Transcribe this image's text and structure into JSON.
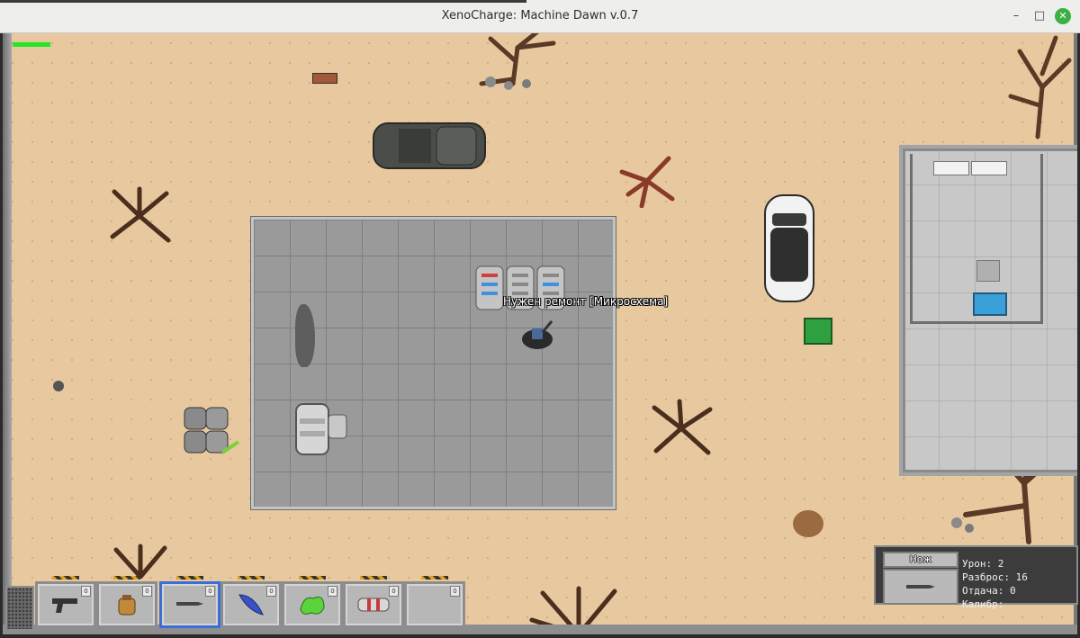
{
  "window": {
    "title": "XenoCharge: Machine Dawn v.0.7",
    "minimize": "–",
    "maximize": "□",
    "close": "✕"
  },
  "hud": {
    "health_fraction": 1.0,
    "health_color": "#24e624",
    "interaction_hint": "Нужен ремонт [Микросхема]"
  },
  "hotbar": {
    "selected_index": 2,
    "selected_color": "#3c6ed6",
    "slots": [
      {
        "icon": "pistol-icon",
        "count": "0"
      },
      {
        "icon": "backpack-icon",
        "count": "0"
      },
      {
        "icon": "knife-icon",
        "count": "0"
      },
      {
        "icon": "blue-claw-icon",
        "count": "0"
      },
      {
        "icon": "green-slime-icon",
        "count": "0"
      },
      {
        "icon": "red-canister-icon",
        "count": "0"
      },
      {
        "icon": "empty-slot",
        "count": "0"
      }
    ]
  },
  "weapon": {
    "name": "Нож",
    "icon": "knife-icon",
    "damage_label": "Урон: 2",
    "spread_label": "Разброс: 16",
    "recoil_label": "Отдача: 0",
    "caliber_label": "Калибр:"
  },
  "colors": {
    "sand": "#e8c99f",
    "floor": "#9a9a9a",
    "accent": "#3c6ed6"
  }
}
